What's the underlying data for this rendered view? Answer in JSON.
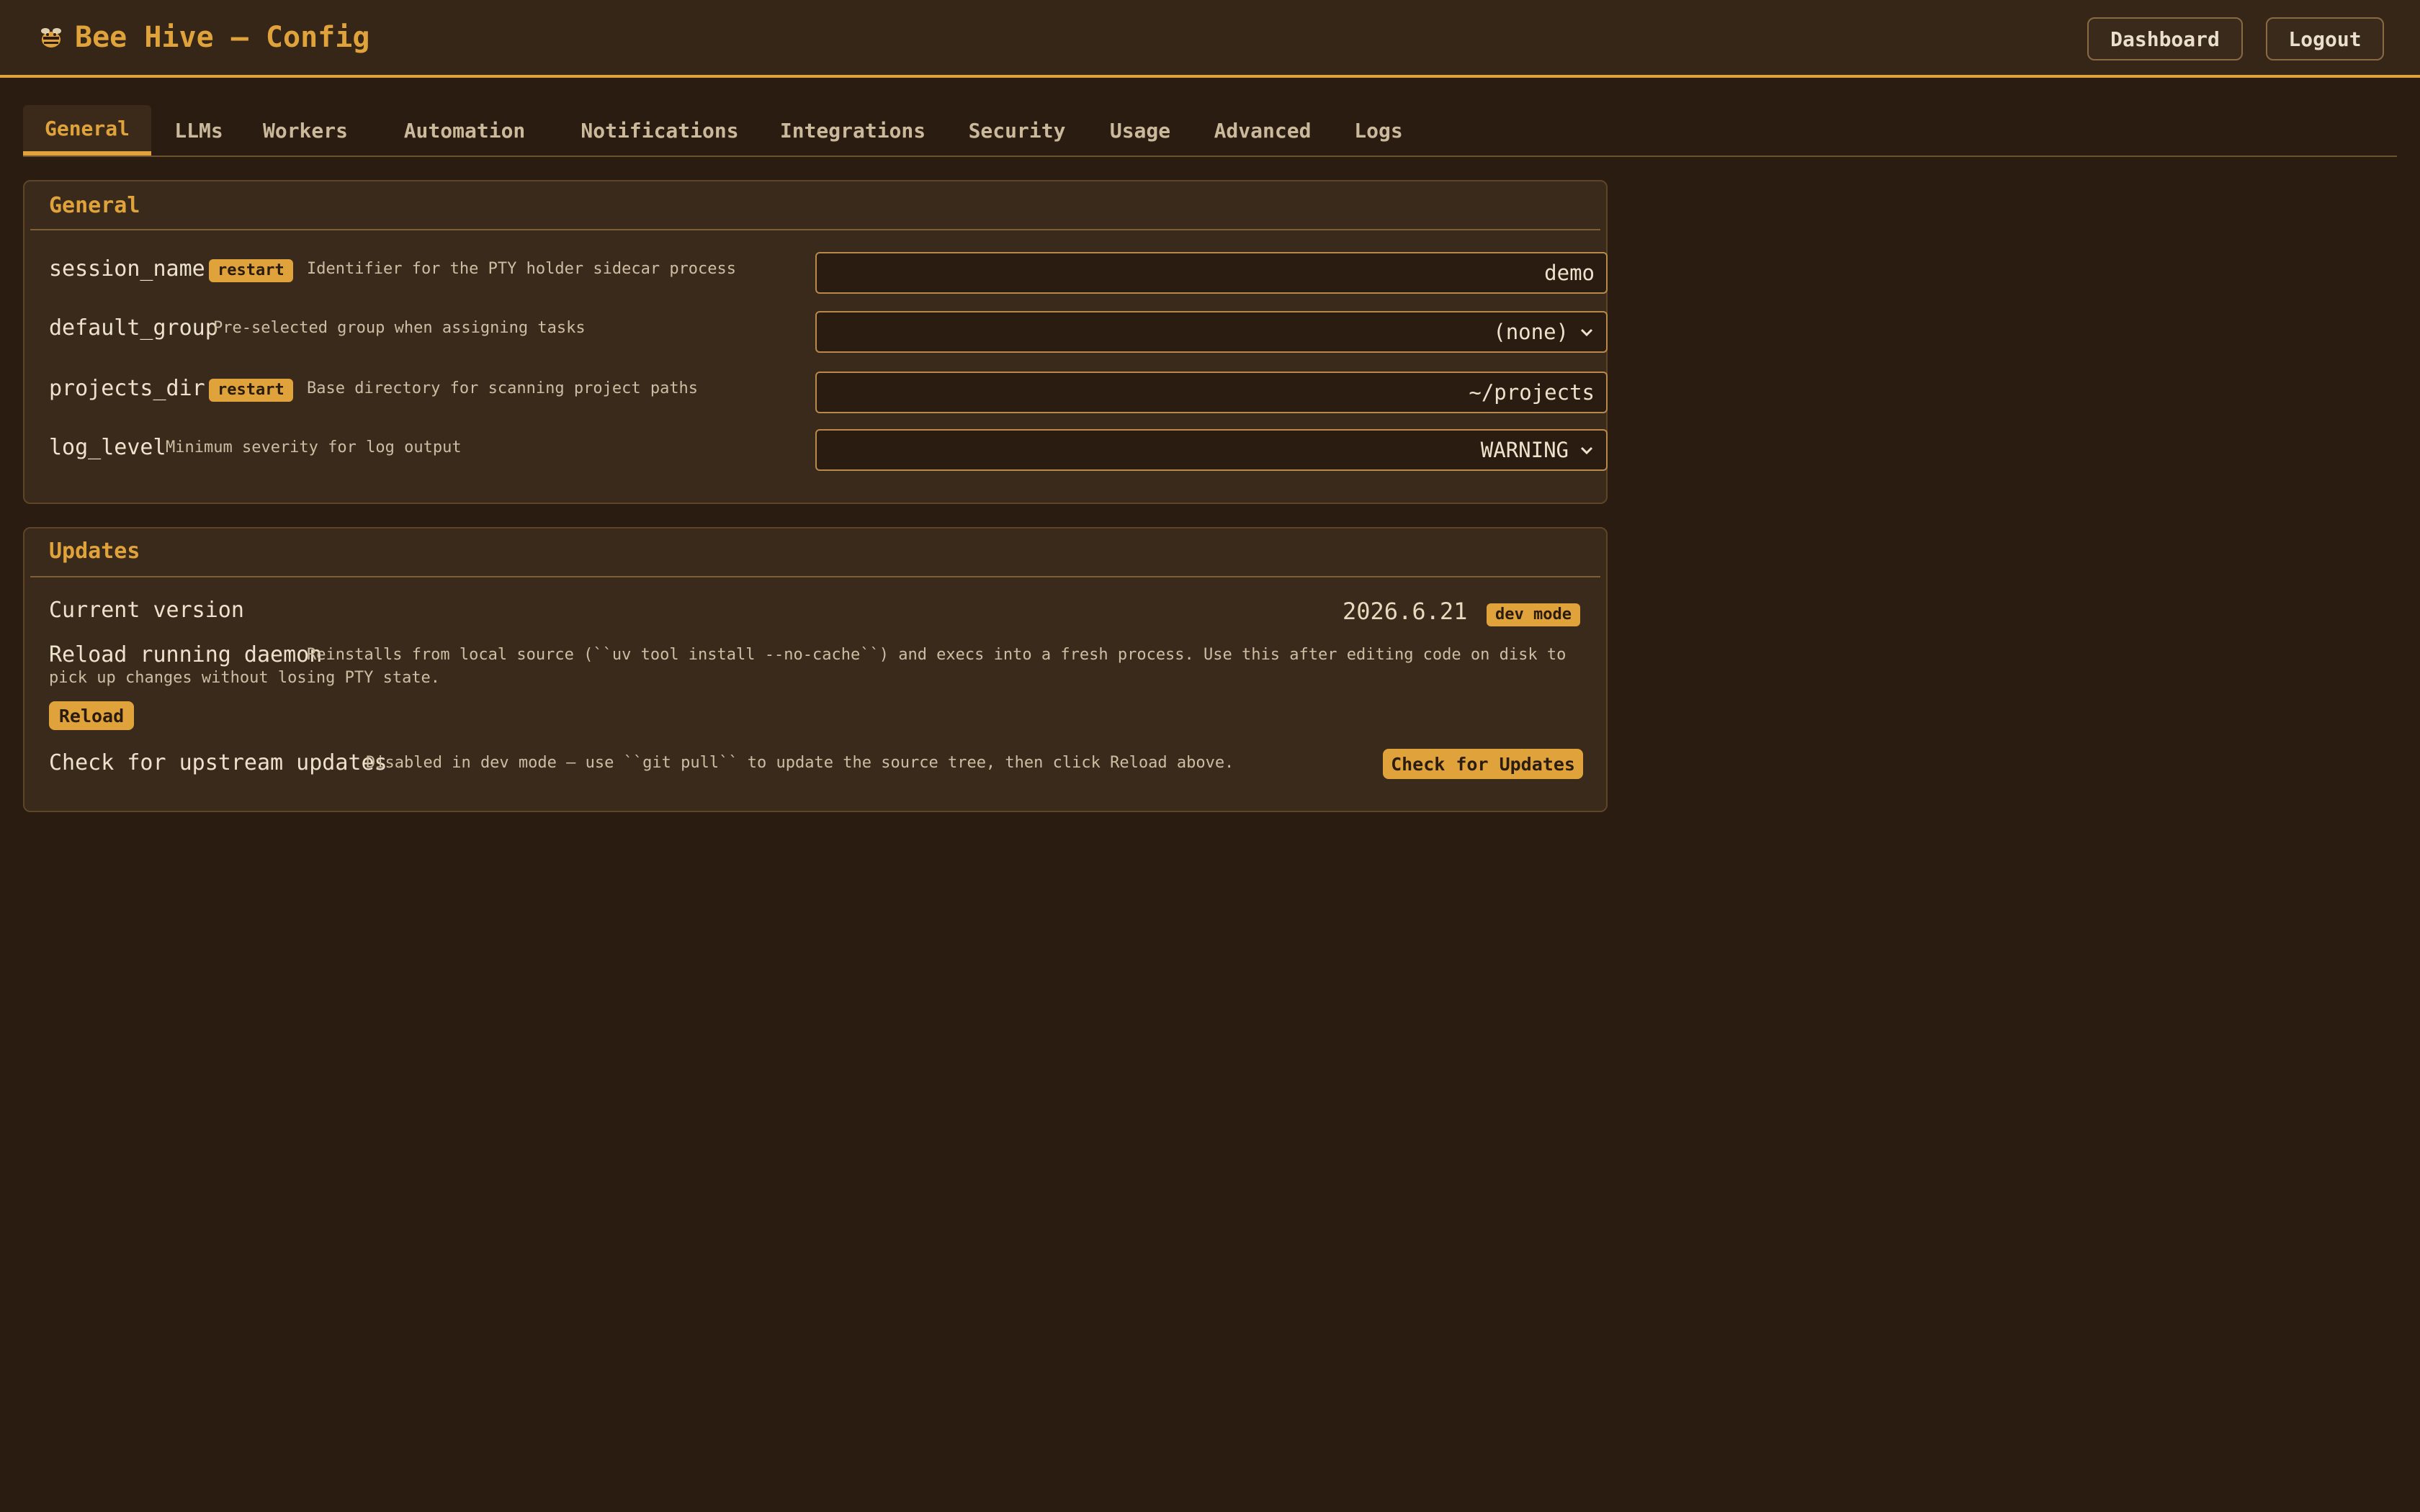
{
  "app": {
    "title": "Bee Hive — Config",
    "logo_icon": "bee-icon",
    "accent_color": "#e0a33b"
  },
  "header": {
    "dashboard_label": "Dashboard",
    "logout_label": "Logout"
  },
  "tabs": [
    {
      "label": "General",
      "active": true
    },
    {
      "label": "LLMs"
    },
    {
      "label": "Workers"
    },
    {
      "label": "Automation"
    },
    {
      "label": "Notifications"
    },
    {
      "label": "Integrations"
    },
    {
      "label": "Security"
    },
    {
      "label": "Usage"
    },
    {
      "label": "Advanced"
    },
    {
      "label": "Logs"
    }
  ],
  "general": {
    "title": "General",
    "settings": [
      {
        "key": "session_name",
        "badge": "restart",
        "description": "Identifier for the PTY holder sidecar process",
        "value": "demo",
        "control": "text"
      },
      {
        "key": "default_group",
        "description": "Pre-selected group when assigning tasks",
        "value": "(none)",
        "control": "select"
      },
      {
        "key": "projects_dir",
        "badge": "restart",
        "description": "Base directory for scanning project paths",
        "value": "~/projects",
        "control": "text"
      },
      {
        "key": "log_level",
        "description": "Minimum severity for log output",
        "value": "WARNING",
        "control": "select"
      }
    ]
  },
  "updates": {
    "title": "Updates",
    "current_version_label": "Current version",
    "current_version": "2026.6.21",
    "mode_badge": "dev mode",
    "reload_label": "Reload running daemon",
    "reload_description": "Reinstalls from local source (``uv tool install --no-cache``) and execs into a fresh process. Use this after editing code on disk to pick up changes without losing PTY state.",
    "reload_button": "Reload",
    "check_label": "Check for upstream updates",
    "check_description": "Disabled in dev mode — use ``git pull`` to update the source tree, then click Reload above.",
    "check_button": "Check for Updates"
  }
}
